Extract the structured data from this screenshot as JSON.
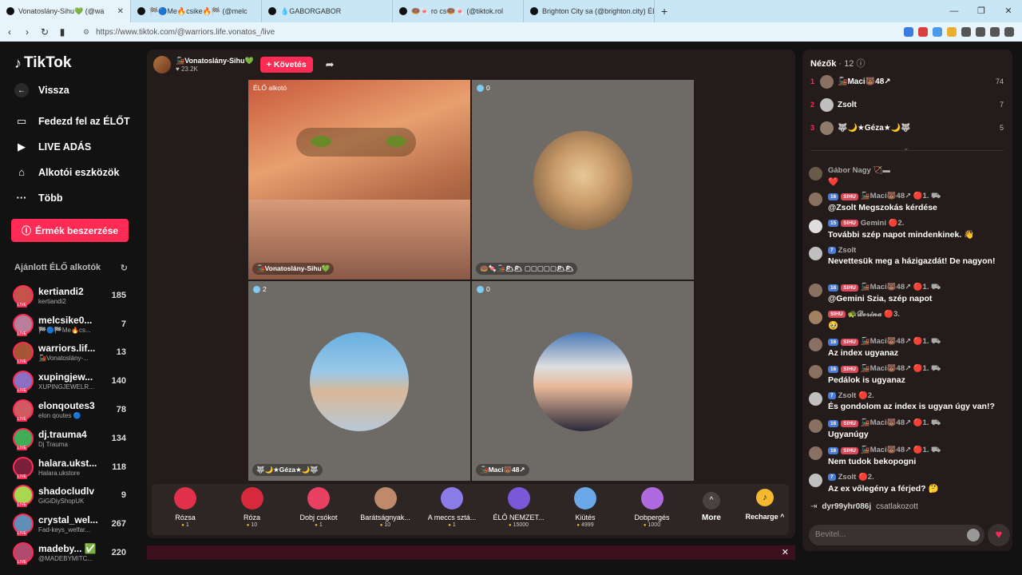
{
  "browser": {
    "tabs": [
      {
        "title": "Vonatoslány-Sihu💚 (@wa",
        "active": true
      },
      {
        "title": "🏁🔵Me🔥csike🔥🏁 (@melc",
        "active": false
      },
      {
        "title": "💧GABORGABOR",
        "active": false
      },
      {
        "title": "🍩🍬 ro cs🍩🍬 (@tiktok.rol",
        "active": false
      },
      {
        "title": "Brighton City sa (@brighton.city) ÉLŐ",
        "active": false
      }
    ],
    "url": "https://www.tiktok.com/@warriors.life.vonatos_/live"
  },
  "sidebar": {
    "logo": "TikTok",
    "back": "Vissza",
    "items": [
      {
        "label": "Fedezd fel az ÉLŐT",
        "icon": "live-explore-icon"
      },
      {
        "label": "LIVE ADÁS",
        "icon": "camera-icon"
      },
      {
        "label": "Alkotói eszközök",
        "icon": "home-tools-icon"
      },
      {
        "label": "Több",
        "icon": "more-dots-icon"
      }
    ],
    "coins_button": "Érmék beszerzése",
    "recommended_title": "Ajánlott ÉLŐ alkotók",
    "recommended": [
      {
        "name": "kertiandi2",
        "sub": "kertiandi2",
        "count": "185",
        "color": "#c7524b"
      },
      {
        "name": "melcsike0...",
        "sub": "🏁🔵🏁Me🔥cs...",
        "count": "7",
        "color": "#b77f9a"
      },
      {
        "name": "warriors.lif...",
        "sub": "🚂Vonatoslány-...",
        "count": "13",
        "color": "#a65535"
      },
      {
        "name": "xupingjew...",
        "sub": "XUPINGJEWELR...",
        "count": "140",
        "color": "#8a6fc2"
      },
      {
        "name": "elonqoutes3",
        "sub": "elon qoutes 🔵",
        "count": "78",
        "color": "#d05b62"
      },
      {
        "name": "dj.trauma4",
        "sub": "Dj Trauma",
        "count": "134",
        "color": "#3fae56"
      },
      {
        "name": "halara.ukst...",
        "sub": "Halara.ukstore",
        "count": "118",
        "color": "#7a1f3c"
      },
      {
        "name": "shadocludlv",
        "sub": "GiGiDiyShopUK",
        "count": "9",
        "color": "#a8d84f"
      },
      {
        "name": "crystal_wel...",
        "sub": "Fad-keys_welfar...",
        "count": "267",
        "color": "#5f8fb8"
      },
      {
        "name": "madeby... ✅",
        "sub": "@MADEBYMITC...",
        "count": "220",
        "color": "#b04a6f"
      }
    ]
  },
  "stream": {
    "host_name": "🚂Vonatoslány-Sihu💚",
    "host_likes": "♥ 23.2K",
    "follow_label": "+ Követés",
    "tiles": [
      {
        "tag": "ÉLŐ alkotó",
        "caption": "🚂Vonatoslány-Sihu💚",
        "count": ""
      },
      {
        "tag": "",
        "caption": "🍩🍬🚂🌥🌥 ▢▢▢▢▢🌥🌥",
        "count": "0"
      },
      {
        "tag": "",
        "caption": "🐺🌙★Géza★🌙🐺",
        "count": "2"
      },
      {
        "tag": "",
        "caption": "🚂Maci🐻48↗",
        "count": "0"
      }
    ],
    "gifts": [
      {
        "name": "Rózsa",
        "price": "1",
        "color": "#e0304a"
      },
      {
        "name": "Róza",
        "price": "10",
        "color": "#d8283c"
      },
      {
        "name": "Dobj csókot",
        "price": "1",
        "color": "#e84060"
      },
      {
        "name": "Barátságnyak...",
        "price": "10",
        "color": "#c08a6a"
      },
      {
        "name": "A meccs sztá...",
        "price": "1",
        "color": "#8a7de8"
      },
      {
        "name": "ÉLŐ NEMZET...",
        "price": "15000",
        "color": "#7a58d8"
      },
      {
        "name": "Kiütés",
        "price": "4999",
        "color": "#6aa8e8"
      },
      {
        "name": "Dobpergés",
        "price": "1000",
        "color": "#b06ae0"
      }
    ],
    "more_label": "More",
    "recharge_label": "Recharge ^"
  },
  "chat": {
    "viewers_label": "Nézők",
    "viewers_count": "· 12 ⓘ",
    "top_viewers": [
      {
        "rank": "1",
        "name": "🚂Maci🐻48↗",
        "count": "74",
        "color": "#8a7060"
      },
      {
        "rank": "2",
        "name": "Zsolt",
        "count": "7",
        "color": "#c0c0c0"
      },
      {
        "rank": "3",
        "name": "🐺🌙★Géza★🌙🐺",
        "count": "5",
        "color": "#907a6a"
      }
    ],
    "messages": [
      {
        "badges": [],
        "name": "Gábor Nagy 🏹▬",
        "text": "❤️",
        "color": "#6a5a4a"
      },
      {
        "badges": [
          "16",
          "SIHU"
        ],
        "name": "🚂Maci🐻48↗ 🔴1. ⛟",
        "text": "@Zsolt Megszokás kérdése",
        "color": "#8a7060"
      },
      {
        "badges": [
          "15",
          "SIHU"
        ],
        "name": "Gemini 🔴2.",
        "text": "További szép napot mindenkinek. 👋",
        "color": "#dedede"
      },
      {
        "badges": [
          "7"
        ],
        "name": "Zsolt",
        "text": "Nevettesük meg a házigazdát! De nagyon!",
        "color": "#c0c0c0"
      },
      {
        "badges": [
          "16",
          "SIHU"
        ],
        "name": "🚂Maci🐻48↗ 🔴1. ⛟",
        "text": "@Gemini Szia, szép napot",
        "color": "#8a7060"
      },
      {
        "badges": [
          "SIHU"
        ],
        "name": "🐢𝓓𝓸𝓻𝓲𝓷𝓪 🔴3.",
        "text": "🥹",
        "color": "#a08060"
      },
      {
        "badges": [
          "16",
          "SIHU"
        ],
        "name": "🚂Maci🐻48↗ 🔴1. ⛟",
        "text": "Az index ugyanaz",
        "color": "#8a7060"
      },
      {
        "badges": [
          "16",
          "SIHU"
        ],
        "name": "🚂Maci🐻48↗ 🔴1. ⛟",
        "text": "Pedálok is ugyanaz",
        "color": "#8a7060"
      },
      {
        "badges": [
          "7"
        ],
        "name": "Zsolt 🔴2.",
        "text": "És gondolom az index is ugyan úgy van!?",
        "color": "#c0c0c0"
      },
      {
        "badges": [
          "16",
          "SIHU"
        ],
        "name": "🚂Maci🐻48↗ 🔴1. ⛟",
        "text": "Ugyanúgy",
        "color": "#8a7060"
      },
      {
        "badges": [
          "16",
          "SIHU"
        ],
        "name": "🚂Maci🐻48↗ 🔴1. ⛟",
        "text": "Nem tudok bekopogni",
        "color": "#8a7060"
      },
      {
        "badges": [
          "7"
        ],
        "name": "Zsolt 🔴2.",
        "text": "Az ex vőlegény a férjed? 🤔",
        "color": "#c0c0c0"
      }
    ],
    "joined_user": "dyr99yhr086j",
    "joined_text": "csatlakozott",
    "input_placeholder": "Bevitel..."
  }
}
